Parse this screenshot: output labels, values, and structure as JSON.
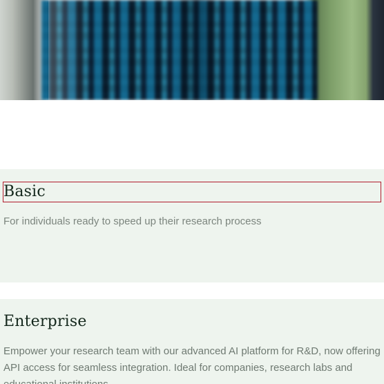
{
  "plans": [
    {
      "name": "Basic",
      "description": "For individuals ready to speed up their research process"
    },
    {
      "name": "Enterprise",
      "description": "Empower your research team with our advanced AI platform for R&D, now offering API access for seamless integration. Ideal for companies, research labs and educational institutions."
    }
  ],
  "colors": {
    "card_background": "#eef4ee",
    "title_text": "#14271c",
    "description_text": "#7c857e",
    "focus_outline": "#b01a2a"
  }
}
